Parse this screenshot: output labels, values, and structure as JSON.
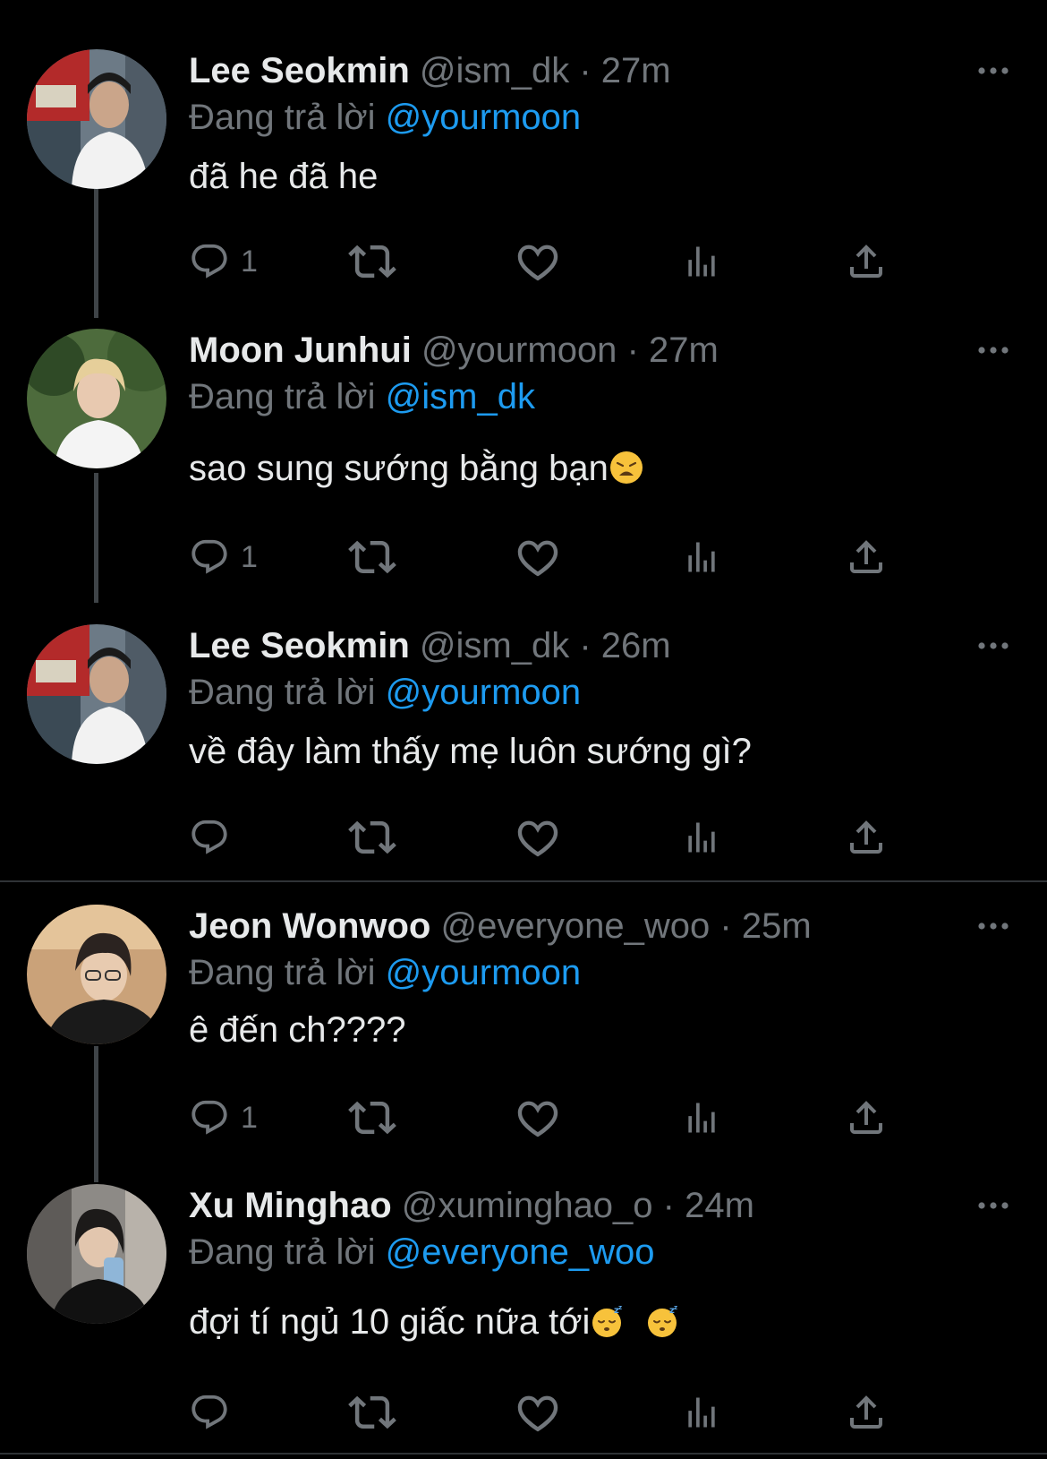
{
  "tweets": [
    {
      "name": "Lee Seokmin",
      "handle": "@ism_dk",
      "time": "27m",
      "replying_prefix": "Đang trả lời",
      "mention": "@yourmoon",
      "text": "đã he đã he",
      "reply_count": "1"
    },
    {
      "name": "Moon Junhui",
      "handle": "@yourmoon",
      "time": "27m",
      "replying_prefix": "Đang trả lời",
      "mention": "@ism_dk",
      "text": "sao sung sướng bằng bạn",
      "reply_count": "1"
    },
    {
      "name": "Lee Seokmin",
      "handle": "@ism_dk",
      "time": "26m",
      "replying_prefix": "Đang trả lời",
      "mention": "@yourmoon",
      "text": "về đây làm thấy mẹ luôn sướng gì?",
      "reply_count": ""
    },
    {
      "name": "Jeon Wonwoo",
      "handle": "@everyone_woo",
      "time": "25m",
      "replying_prefix": "Đang trả lời",
      "mention": "@yourmoon",
      "text": "ê đến ch????",
      "reply_count": "1"
    },
    {
      "name": "Xu Minghao",
      "handle": "@xuminghao_o",
      "time": "24m",
      "replying_prefix": "Đang trả lời",
      "mention": "@everyone_woo",
      "text": "đợi tí ngủ 10 giấc nữa tới",
      "reply_count": ""
    }
  ],
  "separator": "·",
  "colors": {
    "background": "#000000",
    "primary_text": "#e7e9ea",
    "secondary_text": "#71767b",
    "mention": "#1d9bf0",
    "thread_line": "#3f4448",
    "divider": "#2f3336"
  },
  "icons": {
    "reply": "reply-icon",
    "retweet": "retweet-icon",
    "like": "like-icon",
    "views": "views-icon",
    "share": "share-icon",
    "more": "more-icon"
  }
}
